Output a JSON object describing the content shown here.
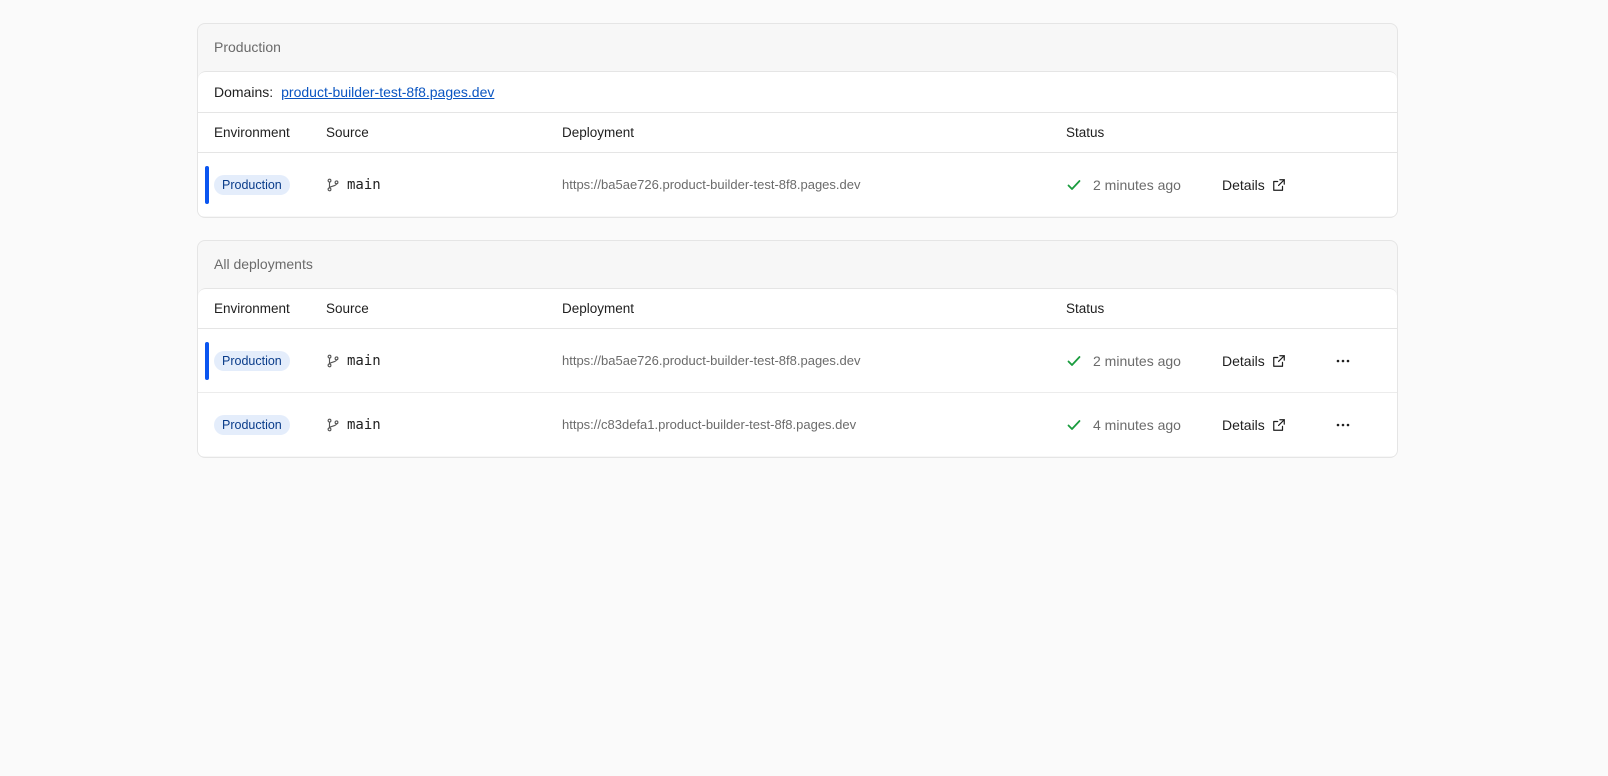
{
  "production": {
    "title": "Production",
    "domains_label": "Domains:",
    "domain": "product-builder-test-8f8.pages.dev",
    "headers": {
      "environment": "Environment",
      "source": "Source",
      "deployment": "Deployment",
      "status": "Status"
    },
    "rows": [
      {
        "environment": "Production",
        "branch": "main",
        "url": "https://ba5ae726.product-builder-test-8f8.pages.dev",
        "status": "2 minutes ago",
        "details": "Details"
      }
    ]
  },
  "all": {
    "title": "All deployments",
    "headers": {
      "environment": "Environment",
      "source": "Source",
      "deployment": "Deployment",
      "status": "Status"
    },
    "rows": [
      {
        "environment": "Production",
        "branch": "main",
        "url": "https://ba5ae726.product-builder-test-8f8.pages.dev",
        "status": "2 minutes ago",
        "details": "Details"
      },
      {
        "environment": "Production",
        "branch": "main",
        "url": "https://c83defa1.product-builder-test-8f8.pages.dev",
        "status": "4 minutes ago",
        "details": "Details"
      }
    ]
  },
  "colors": {
    "accent": "#0a55f0",
    "link": "#0a55c2",
    "success": "#1a9c3e",
    "badge_bg": "#e4edfb"
  },
  "icons": {
    "branch": "git-branch-icon",
    "check": "check-icon",
    "external": "external-link-icon",
    "more": "more-horizontal-icon"
  }
}
